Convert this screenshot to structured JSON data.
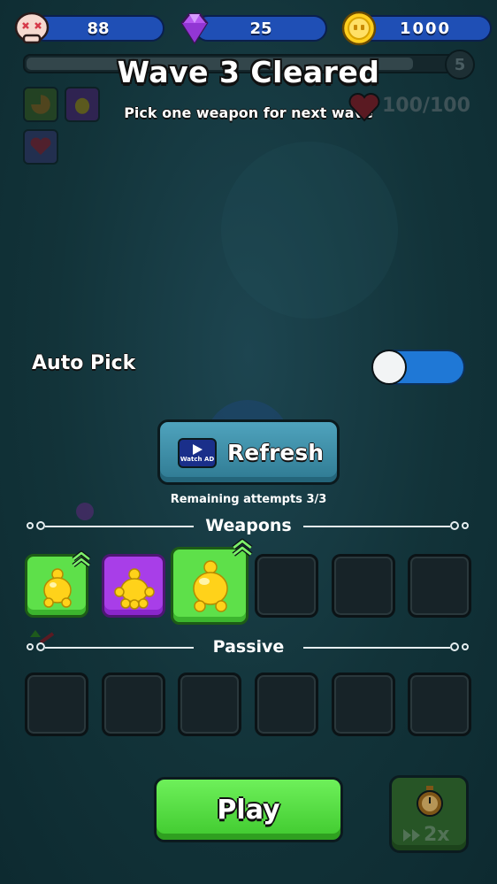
{
  "currency": {
    "skulls": "88",
    "gems": "25",
    "coins": "1000"
  },
  "wave": {
    "title": "Wave 3 Cleared",
    "subtitle": "Pick one weapon for next wave",
    "level_badge": "5",
    "progress_fraction": 0.9
  },
  "health": {
    "text": "100/100"
  },
  "auto_pick": {
    "label": "Auto Pick",
    "enabled": false
  },
  "refresh": {
    "label": "Refresh",
    "ad_label": "Watch AD",
    "remaining": "Remaining attempts 3/3"
  },
  "weapons": {
    "title": "Weapons",
    "slots": [
      {
        "rarity": "green",
        "icon": "yellow-blob-icon",
        "upgradable": true
      },
      {
        "rarity": "purple",
        "icon": "yellow-blob-icon",
        "upgradable": false
      },
      {
        "rarity": "green",
        "icon": "yellow-blob-icon",
        "upgradable": true
      },
      {
        "rarity": "empty"
      },
      {
        "rarity": "empty"
      },
      {
        "rarity": "empty"
      }
    ]
  },
  "passive": {
    "title": "Passive",
    "slots": 6
  },
  "play": {
    "label": "Play"
  },
  "speed": {
    "label": "2x"
  },
  "colors": {
    "green": "#5ee04a",
    "purple": "#a83ee8",
    "blue": "#1f4fb5",
    "background": "#123339"
  }
}
